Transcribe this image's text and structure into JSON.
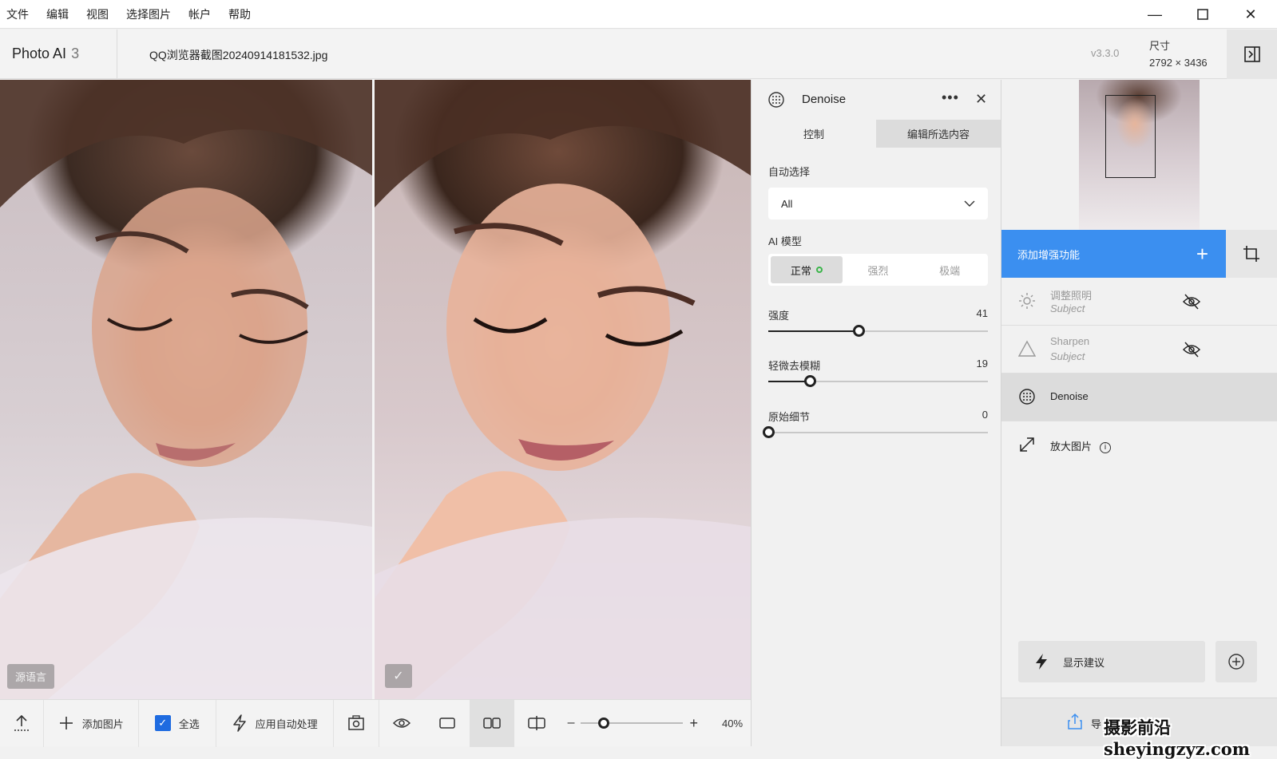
{
  "menubar": {
    "items": [
      "文件",
      "编辑",
      "视图",
      "选择图片",
      "帐户",
      "帮助"
    ]
  },
  "header": {
    "brand": "Photo AI",
    "brand_version_num": "3",
    "filename": "QQ浏览器截图20240914181532.jpg",
    "app_version": "v3.3.0",
    "size_label": "尺寸",
    "size_value": "2792 × 3436"
  },
  "viewer": {
    "left_badge": "源语言",
    "right_badge": "✓"
  },
  "toolbar": {
    "add_image": "添加图片",
    "select_all": "全选",
    "select_all_checked": true,
    "auto_process": "应用自动处理",
    "zoom_value": "40%",
    "zoom_minus": "–",
    "zoom_plus": "+",
    "zoom_fraction": 0.17
  },
  "control_panel": {
    "title": "Denoise",
    "more": "•••",
    "close": "✕",
    "tabs": [
      "控制",
      "编辑所选内容"
    ],
    "auto_select_label": "自动选择",
    "auto_select_value": "All",
    "ai_model_label": "AI 模型",
    "models": [
      "正常",
      "强烈",
      "极端"
    ],
    "selected_model": "正常",
    "sliders": [
      {
        "name": "强度",
        "value": 41
      },
      {
        "name": "轻微去模糊",
        "value": 19
      },
      {
        "name": "原始细节",
        "value": 0
      }
    ]
  },
  "right_panel": {
    "add_enhancement": "添加增强功能",
    "enhancements": [
      {
        "name": "调整照明",
        "sub": "Subject",
        "hidden": true
      },
      {
        "name": "Sharpen",
        "sub": "Subject",
        "hidden": true
      },
      {
        "name": "Denoise",
        "selected": true
      },
      {
        "name": "放大图片",
        "info": "i"
      }
    ],
    "show_suggestions": "显示建议",
    "export_label": "导"
  },
  "watermark": "摄影前沿 sheyingzyz.com",
  "colors": {
    "accent": "#3b8ff0",
    "checkbox": "#1e6be0",
    "model_dot": "#3bb54a"
  }
}
